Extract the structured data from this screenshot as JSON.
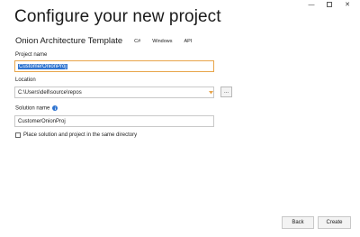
{
  "window": {
    "minimize_glyph": "—",
    "close_glyph": "✕"
  },
  "page": {
    "title": "Configure your new project"
  },
  "template": {
    "name": "Onion Architecture Template",
    "tags": [
      "C#",
      "Windows",
      "API"
    ]
  },
  "project_name": {
    "label": "Project name",
    "value": "CustomerOnionProj"
  },
  "location": {
    "label": "Location",
    "value": "C:\\Users\\dell\\source\\repos",
    "browse_label": "..."
  },
  "solution_name": {
    "label": "Solution name",
    "info_glyph": "i",
    "value": "CustomerOnionProj"
  },
  "same_directory": {
    "label": "Place solution and project in the same directory",
    "checked": false
  },
  "footer": {
    "back_label": "Back",
    "create_label": "Create"
  },
  "colors": {
    "accent": "#2f74d0",
    "focus_border": "#e8a54a",
    "dropdown_arrow": "#e8a54a"
  },
  "icons": {
    "minimize": "minimize-icon",
    "maximize": "maximize-icon",
    "close": "close-icon",
    "dropdown": "chevron-down-icon",
    "info": "info-icon"
  }
}
